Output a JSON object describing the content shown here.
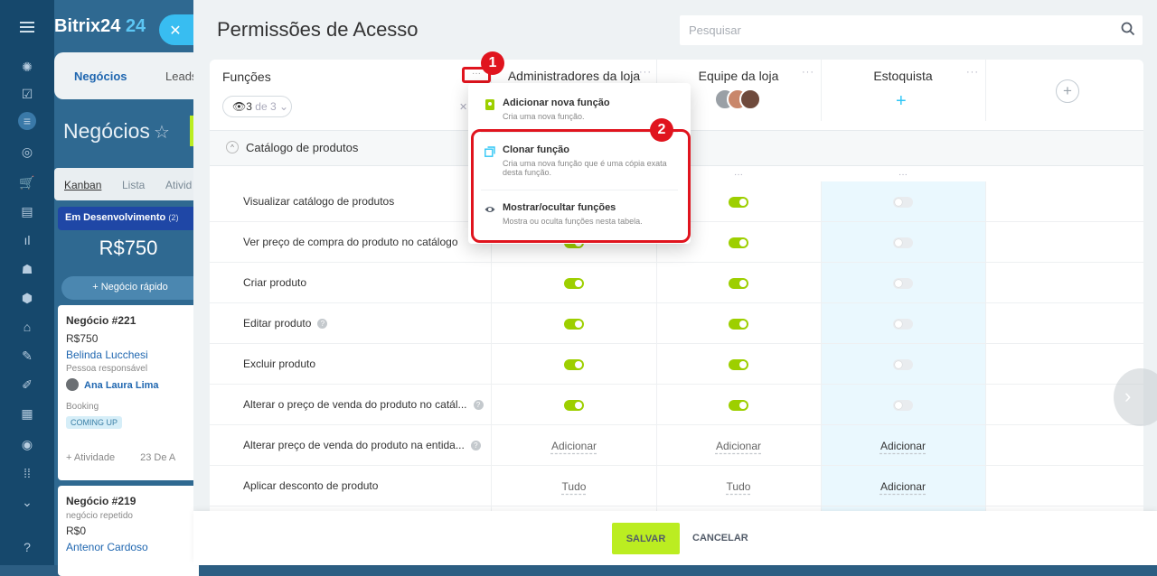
{
  "brand": {
    "name": "Bitrix24",
    "suffix": "24"
  },
  "background_app": {
    "tabs": [
      "Negócios",
      "Leads"
    ],
    "page_title": "Negócios",
    "view_tabs": [
      "Kanban",
      "Lista",
      "Ativid"
    ],
    "stage": {
      "name": "Em Desenvolvimento",
      "count": "(2)",
      "sum": "R$750"
    },
    "quick_deal": "+ Negócio rápido",
    "cards": [
      {
        "title": "Negócio #221",
        "amount": "R$750",
        "contact": "Belinda Lucchesi",
        "resp_label": "Pessoa responsável",
        "resp_name": "Ana Laura Lima",
        "tag_label": "Booking",
        "tag": "COMING UP",
        "activity": "+ Atividade",
        "date": "23 De A"
      },
      {
        "title": "Negócio #219",
        "subtitle": "negócio repetido",
        "amount": "R$0",
        "contact": "Antenor Cardoso"
      }
    ]
  },
  "slider": {
    "title": "Permissões de Acesso",
    "search_placeholder": "Pesquisar",
    "roles_header": "Funções",
    "roles_filter": {
      "visible": "3",
      "of": "de 3"
    },
    "columns": [
      {
        "name": "Administradores da loja"
      },
      {
        "name": "Equipe da loja"
      },
      {
        "name": "Estoquista"
      }
    ],
    "section": "Catálogo de produtos",
    "rows": [
      {
        "label": "Visualizar catálogo de produtos",
        "help": false,
        "values": [
          "on",
          "on",
          "off"
        ]
      },
      {
        "label": "Ver preço de compra do produto no catálogo",
        "help": false,
        "values": [
          "on",
          "on",
          "off"
        ]
      },
      {
        "label": "Criar produto",
        "help": false,
        "values": [
          "on",
          "on",
          "off"
        ]
      },
      {
        "label": "Editar produto",
        "help": true,
        "values": [
          "on",
          "on",
          "off"
        ]
      },
      {
        "label": "Excluir produto",
        "help": false,
        "values": [
          "on",
          "on",
          "off"
        ]
      },
      {
        "label": "Alterar o preço de venda do produto no catál...",
        "help": true,
        "values": [
          "on",
          "on",
          "off"
        ]
      },
      {
        "label": "Alterar preço de venda do produto na entida...",
        "help": true,
        "values": [
          "Adicionar",
          "Adicionar",
          "Adicionar"
        ]
      },
      {
        "label": "Aplicar desconto de produto",
        "help": false,
        "values": [
          "Tudo",
          "Tudo",
          "Adicionar"
        ]
      }
    ],
    "menu": [
      {
        "title": "Adicionar nova função",
        "desc": "Cria uma nova função."
      },
      {
        "title": "Clonar função",
        "desc": "Cria uma nova função que é uma cópia exata desta função."
      },
      {
        "title": "Mostrar/ocultar funções",
        "desc": "Mostra ou oculta funções nesta tabela."
      }
    ],
    "markers": [
      "1",
      "2"
    ],
    "footer": {
      "save": "SALVAR",
      "cancel": "CANCELAR"
    }
  },
  "colors": {
    "accent_green": "#bbed21",
    "toggle_on": "#9dcf00",
    "highlight_red": "#e0141e",
    "nav_bg": "#16486c",
    "selected_column": "#eaf8fe"
  }
}
